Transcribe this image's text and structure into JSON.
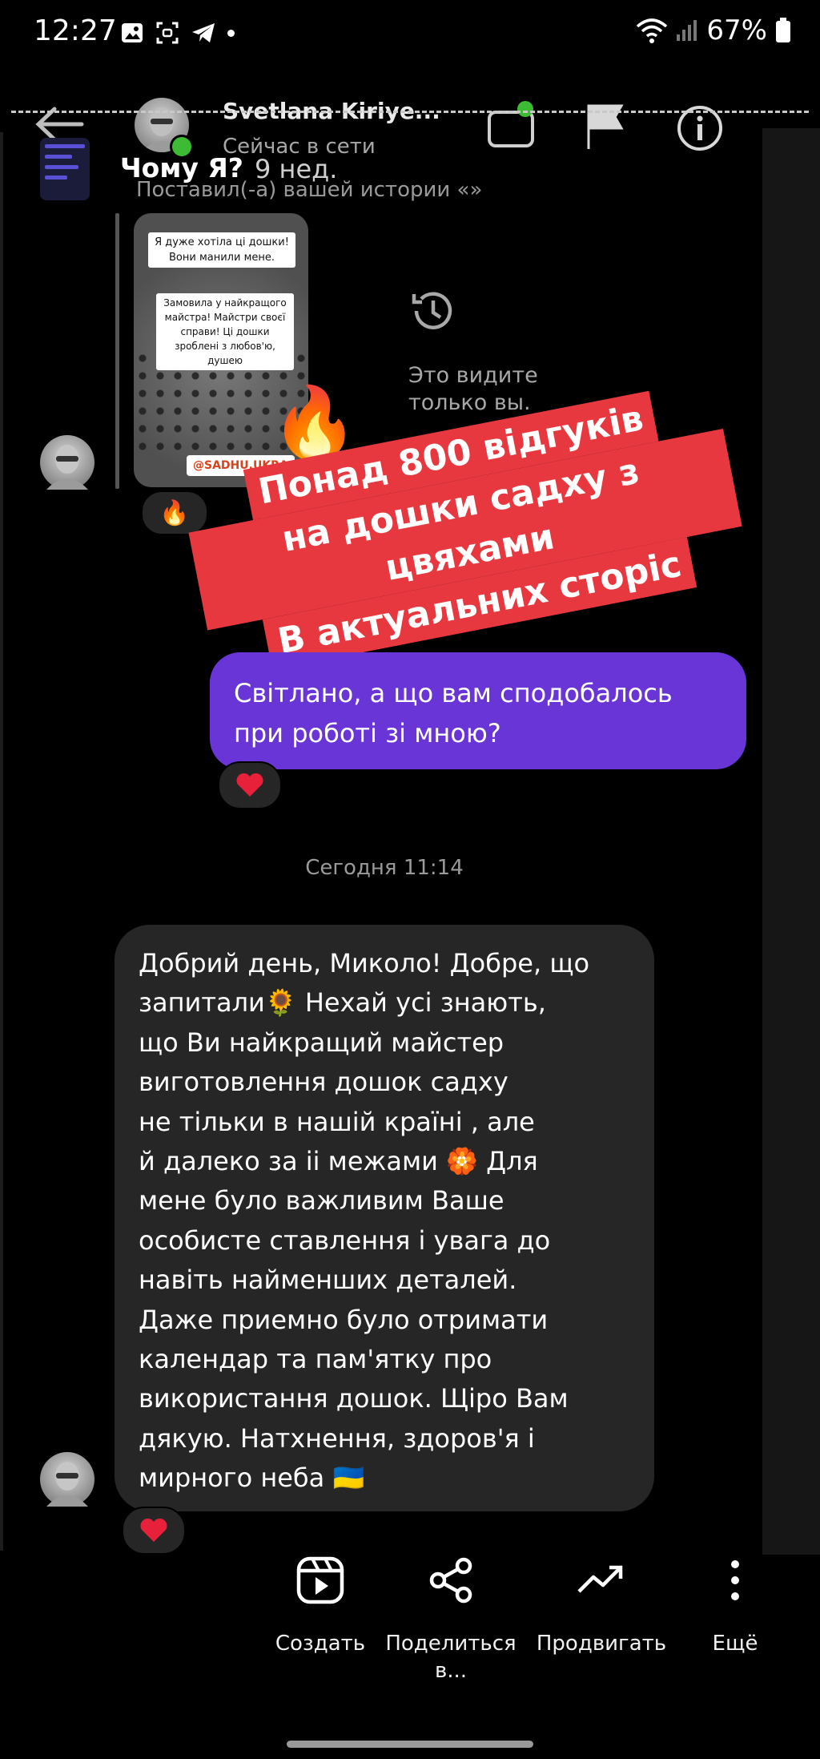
{
  "status_bar": {
    "time": "12:27",
    "battery": "67%"
  },
  "header": {
    "contact_name": "Svetlana Kiriye...",
    "contact_status": "Сейчас в сети"
  },
  "story_highlight": {
    "name": "Чому Я?",
    "time": "9 нед."
  },
  "story_reply": {
    "caption": "Поставил(-а) вашей истории «»",
    "card_text_1": "Я дуже хотіла ці дошки! Вони манили мене.",
    "card_text_2": "Замовила у найкращого майстра! Майстри своєї справи! Ці дошки зроблені з любов'ю, душею",
    "card_tag": "@SADHU.UKRA",
    "hidden_note": "Это видите только вы.",
    "reaction": "🔥"
  },
  "promo_banner": {
    "line1": "Понад 800 відгуків",
    "line2": "на дошки садху з цвяхами",
    "line3": "В актуальних сторіс"
  },
  "messages": {
    "outgoing_text": "Світлано, а що вам сподобалось при роботі зі мною?",
    "outgoing_reaction": "❤️",
    "date_separator": "Сегодня 11:14",
    "incoming_text": "Добрий день, Миколо! Добре, що\nзапитали🌻 Нехай усі знають,\nщо Ви найкращий майстер\nвиготовлення дошок садху\nне тільки  в нашій країні , але\nй далеко за іі межами 🏵️ Для\nмене було важливим Ваше\nособисте ставлення і увага до\nнавіть найменших  деталей.\nДаже приемно було отримати\nкалендар та пам'ятку про\nвикористання дошок. Щіро Вам\nдякую. Натхнення,  здоров'я і\nмирного неба 🇺🇦",
    "incoming_reaction": "❤️"
  },
  "actions": [
    {
      "label": "Создать",
      "icon": "reel-icon"
    },
    {
      "label": "Поделиться в...",
      "icon": "share-icon"
    },
    {
      "label": "Продвигать",
      "icon": "trend-icon"
    },
    {
      "label": "Ещё",
      "icon": "more-icon"
    }
  ],
  "colors": {
    "outgoing_bubble": "#6a35d6",
    "incoming_bubble": "#262626",
    "promo_red": "#e8383f",
    "online_green": "#3dbb34"
  }
}
